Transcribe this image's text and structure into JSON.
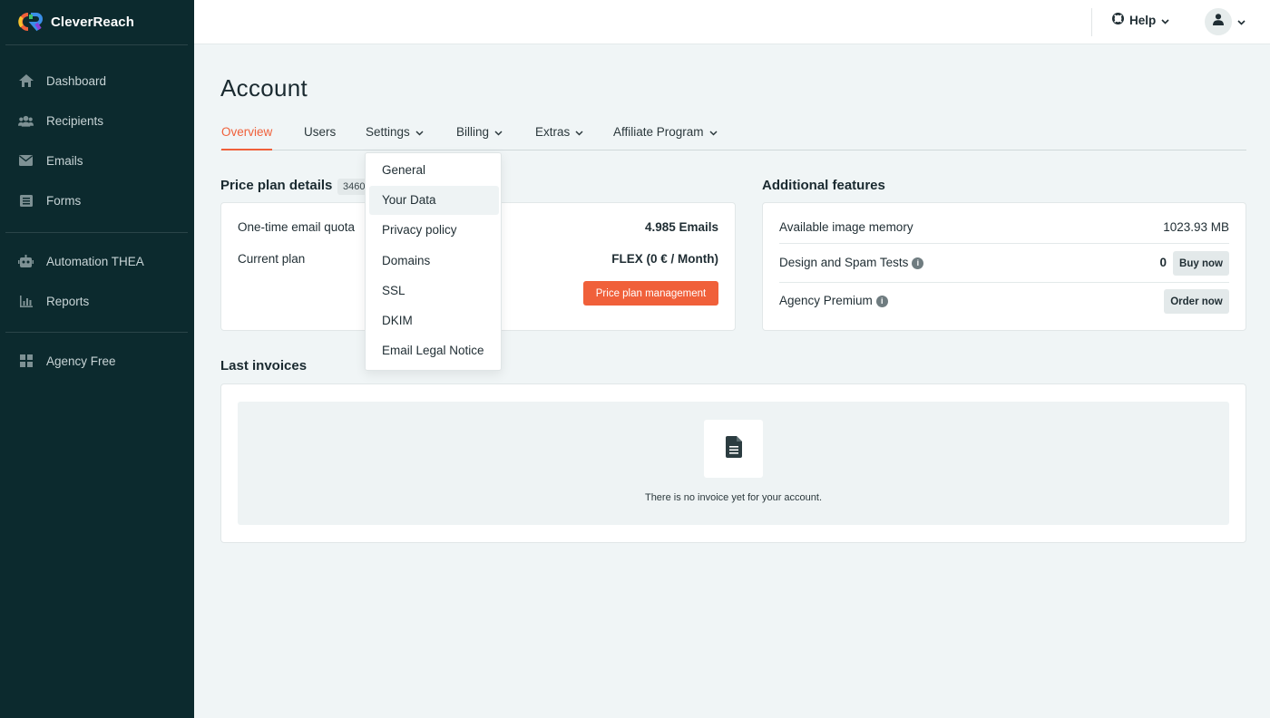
{
  "brand": {
    "name": "CleverReach"
  },
  "sidebar": {
    "items": [
      {
        "label": "Dashboard",
        "icon": "home-icon"
      },
      {
        "label": "Recipients",
        "icon": "users-icon"
      },
      {
        "label": "Emails",
        "icon": "envelope-icon"
      },
      {
        "label": "Forms",
        "icon": "form-icon"
      },
      {
        "label": "Automation THEA",
        "icon": "robot-icon"
      },
      {
        "label": "Reports",
        "icon": "bar-chart-icon"
      },
      {
        "label": "Agency Free",
        "icon": "grid-icon"
      }
    ]
  },
  "topbar": {
    "help_label": "Help"
  },
  "page": {
    "title": "Account"
  },
  "tabs": [
    {
      "label": "Overview",
      "active": true
    },
    {
      "label": "Users"
    },
    {
      "label": "Settings",
      "has_dropdown": true
    },
    {
      "label": "Billing",
      "has_dropdown": true
    },
    {
      "label": "Extras",
      "has_dropdown": true
    },
    {
      "label": "Affiliate Program",
      "has_dropdown": true
    }
  ],
  "settings_menu": {
    "items": [
      "General",
      "Your Data",
      "Privacy policy",
      "Domains",
      "SSL",
      "DKIM",
      "Email Legal Notice"
    ],
    "hovered": "Your Data"
  },
  "price_plan": {
    "title": "Price plan details",
    "badge": "3460",
    "rows": [
      {
        "label": "One-time email quota",
        "value": "4.985 Emails"
      },
      {
        "label": "Current plan",
        "value": "FLEX (0 € / Month)"
      }
    ],
    "button_label": "Price plan management"
  },
  "additional_features": {
    "title": "Additional features",
    "rows": [
      {
        "label": "Available image memory",
        "value": "1023.93 MB"
      },
      {
        "label": "Design and Spam Tests",
        "value": "0",
        "button": "Buy now"
      },
      {
        "label": "Agency Premium",
        "button": "Order now"
      }
    ]
  },
  "invoices": {
    "title": "Last invoices",
    "empty_text": "There is no invoice yet for your account."
  },
  "colors": {
    "sidebar_bg": "#0c2a2e",
    "accent": "#f0603a",
    "page_bg": "#f0f5f6"
  }
}
